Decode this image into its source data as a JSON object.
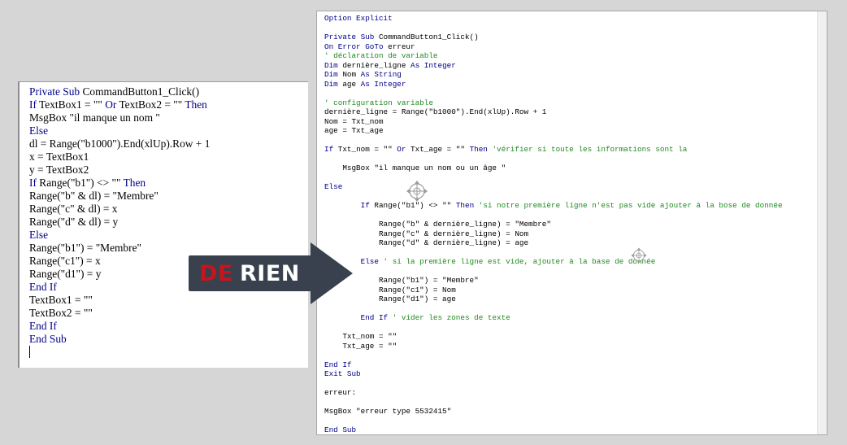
{
  "left_editor": {
    "lines": [
      [
        {
          "t": "Private Sub ",
          "k": 1
        },
        {
          "t": "CommandButton1_Click()"
        }
      ],
      [
        {
          "t": "If ",
          "k": 1
        },
        {
          "t": "TextBox1 = \"\" "
        },
        {
          "t": "Or ",
          "k": 1
        },
        {
          "t": "TextBox2 = \"\" "
        },
        {
          "t": "Then",
          "k": 1
        }
      ],
      [
        {
          "t": "MsgBox \"il manque un nom \""
        }
      ],
      [
        {
          "t": "Else",
          "k": 1
        }
      ],
      [
        {
          "t": "dl = Range(\"b1000\").End(xlUp).Row + 1"
        }
      ],
      [
        {
          "t": "x = TextBox1"
        }
      ],
      [
        {
          "t": "y = TextBox2"
        }
      ],
      [
        {
          "t": "If ",
          "k": 1
        },
        {
          "t": "Range(\"b1\") <> \"\" "
        },
        {
          "t": "Then",
          "k": 1
        }
      ],
      [
        {
          "t": "Range(\"b\" & dl) = \"Membre\""
        }
      ],
      [
        {
          "t": "Range(\"c\" & dl) = x"
        }
      ],
      [
        {
          "t": "Range(\"d\" & dl) = y"
        }
      ],
      [
        {
          "t": "Else",
          "k": 1
        }
      ],
      [
        {
          "t": "Range(\"b1\") = \"Membre\""
        }
      ],
      [
        {
          "t": "Range(\"c1\") = x"
        }
      ],
      [
        {
          "t": "Range(\"d1\") = y"
        }
      ],
      [
        {
          "t": "End If",
          "k": 1
        }
      ],
      [
        {
          "t": "TextBox1 = \"\""
        }
      ],
      [
        {
          "t": "TextBox2 = \"\""
        }
      ],
      [
        {
          "t": "End If",
          "k": 1
        }
      ],
      [
        {
          "t": "End Sub",
          "k": 1
        }
      ]
    ]
  },
  "right_editor": {
    "lines": [
      [
        {
          "t": "Option Explicit",
          "k": 1
        }
      ],
      [],
      [
        {
          "t": "Private Sub ",
          "k": 1
        },
        {
          "t": "CommandButton1_Click()"
        }
      ],
      [
        {
          "t": "On Error GoTo ",
          "k": 1
        },
        {
          "t": "erreur"
        }
      ],
      [
        {
          "t": "' déclaration de variable",
          "c": 1
        }
      ],
      [
        {
          "t": "Dim ",
          "k": 1
        },
        {
          "t": "dernière_ligne "
        },
        {
          "t": "As Integer",
          "k": 1
        }
      ],
      [
        {
          "t": "Dim ",
          "k": 1
        },
        {
          "t": "Nom "
        },
        {
          "t": "As String",
          "k": 1
        }
      ],
      [
        {
          "t": "Dim ",
          "k": 1
        },
        {
          "t": "age "
        },
        {
          "t": "As Integer",
          "k": 1
        }
      ],
      [],
      [
        {
          "t": "' configuration variable",
          "c": 1
        }
      ],
      [
        {
          "t": "dernière_ligne = Range(\"b1000\").End(xlUp).Row + 1"
        }
      ],
      [
        {
          "t": "Nom = Txt_nom"
        }
      ],
      [
        {
          "t": "age = Txt_age"
        }
      ],
      [],
      [
        {
          "t": "If ",
          "k": 1
        },
        {
          "t": "Txt_nom = \"\" "
        },
        {
          "t": "Or ",
          "k": 1
        },
        {
          "t": "Txt_age = \"\" "
        },
        {
          "t": "Then ",
          "k": 1
        },
        {
          "t": "'vérifier si toute les informations sont la",
          "c": 1
        }
      ],
      [],
      [
        {
          "t": "    MsgBox \"il manque un nom ou un âge \""
        }
      ],
      [],
      [
        {
          "t": "Else",
          "k": 1
        }
      ],
      [],
      [
        {
          "t": "        "
        },
        {
          "t": "If ",
          "k": 1
        },
        {
          "t": "Range(\"b1\") <> \"\" "
        },
        {
          "t": "Then ",
          "k": 1
        },
        {
          "t": "'si notre première ligne n'est pas vide ajouter à la bose de donnée",
          "c": 1
        }
      ],
      [],
      [
        {
          "t": "            Range(\"b\" & dernière_ligne) = \"Membre\""
        }
      ],
      [
        {
          "t": "            Range(\"c\" & dernière_ligne) = Nom"
        }
      ],
      [
        {
          "t": "            Range(\"d\" & dernière_ligne) = age"
        }
      ],
      [],
      [
        {
          "t": "        "
        },
        {
          "t": "Else ",
          "k": 1
        },
        {
          "t": "' si la première ligne est vide, ajouter à la base de donnée",
          "c": 1
        }
      ],
      [],
      [
        {
          "t": "            Range(\"b1\") = \"Membre\""
        }
      ],
      [
        {
          "t": "            Range(\"c1\") = Nom"
        }
      ],
      [
        {
          "t": "            Range(\"d1\") = age"
        }
      ],
      [],
      [
        {
          "t": "        "
        },
        {
          "t": "End If ",
          "k": 1
        },
        {
          "t": "' vider les zones de texte",
          "c": 1
        }
      ],
      [],
      [
        {
          "t": "    Txt_nom = \"\""
        }
      ],
      [
        {
          "t": "    Txt_age = \"\""
        }
      ],
      [],
      [
        {
          "t": "End If",
          "k": 1
        }
      ],
      [
        {
          "t": "Exit Sub",
          "k": 1
        }
      ],
      [],
      [
        {
          "t": "erreur:"
        }
      ],
      [],
      [
        {
          "t": "MsgBox \"erreur type 5532415\""
        }
      ],
      [],
      [
        {
          "t": "End Sub",
          "k": 1
        }
      ]
    ]
  },
  "banner": {
    "word1": "DE",
    "word2": "RIEN"
  },
  "colors": {
    "keyword": "#00008b",
    "comment": "#1e8b1e",
    "text": "#000000",
    "arrow": "#38414d",
    "banner_red": "#c8141e"
  },
  "icons": [
    "move-cursor-icon",
    "move-cursor-icon"
  ]
}
